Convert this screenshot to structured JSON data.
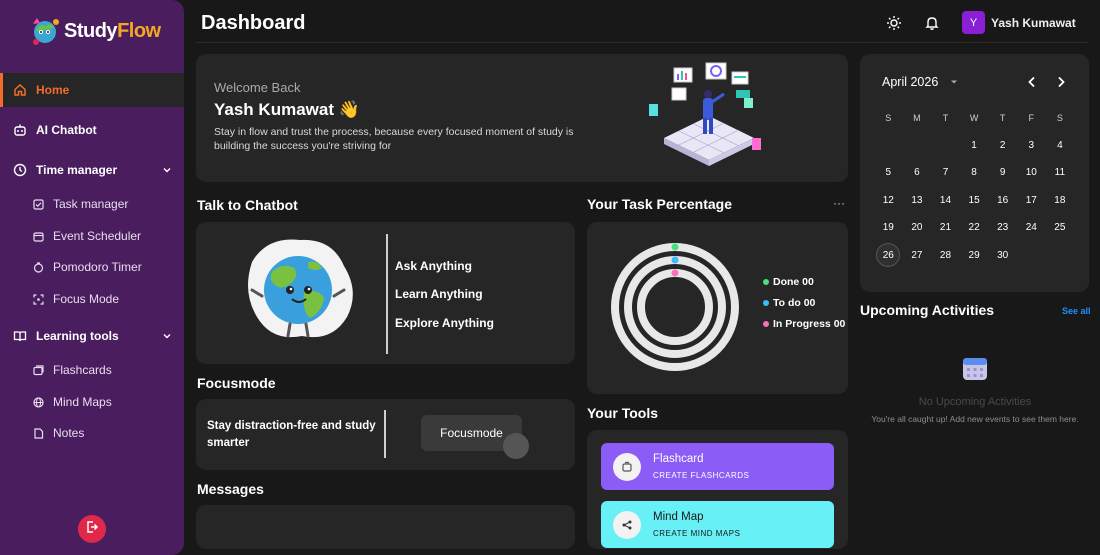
{
  "brand": {
    "name_a": "Study",
    "name_b": "Flow"
  },
  "sidebar": {
    "home": "Home",
    "chatbot": "AI Chatbot",
    "time_manager": "Time manager",
    "time_items": [
      "Task manager",
      "Event Scheduler",
      "Pomodoro Timer",
      "Focus Mode"
    ],
    "learning_tools": "Learning tools",
    "learning_items": [
      "Flashcards",
      "Mind Maps",
      "Notes"
    ]
  },
  "header": {
    "title": "Dashboard",
    "avatar_initial": "Y",
    "user_name": "Yash Kumawat"
  },
  "welcome": {
    "greeting": "Welcome Back",
    "name": "Yash Kumawat",
    "wave": "👋",
    "text": "Stay in flow and trust the process, because every focused moment of study is building the success you're striving for"
  },
  "chatbot": {
    "title": "Talk to Chatbot",
    "options": [
      "Ask Anything",
      "Learn Anything",
      "Explore Anything"
    ]
  },
  "focusmode": {
    "title": "Focusmode",
    "text": "Stay distraction-free and study smarter",
    "button": "Focusmode"
  },
  "messages": {
    "title": "Messages"
  },
  "tasks": {
    "title": "Your Task Percentage",
    "more": "···",
    "legend": [
      {
        "label": "Done 00",
        "color": "#4ade80"
      },
      {
        "label": "To do 00",
        "color": "#38bdf8"
      },
      {
        "label": "In Progress 00",
        "color": "#f472b6"
      }
    ]
  },
  "tools": {
    "title": "Your Tools",
    "items": [
      {
        "title": "Flashcard",
        "sub": "CREATE FLASHCARDS",
        "bg": "#8b5cf6",
        "fg": "#ffffff"
      },
      {
        "title": "Mind Map",
        "sub": "CREATE MIND MAPS",
        "bg": "#67f0f5",
        "fg": "#1a1a1a"
      }
    ]
  },
  "calendar": {
    "month": "April 2026",
    "weekdays": [
      "S",
      "M",
      "T",
      "W",
      "T",
      "F",
      "S"
    ],
    "weeks": [
      [
        "",
        "",
        "",
        "1",
        "2",
        "3",
        "4"
      ],
      [
        "5",
        "6",
        "7",
        "8",
        "9",
        "10",
        "11"
      ],
      [
        "12",
        "13",
        "14",
        "15",
        "16",
        "17",
        "18"
      ],
      [
        "19",
        "20",
        "21",
        "22",
        "23",
        "24",
        "25"
      ],
      [
        "26",
        "27",
        "28",
        "29",
        "30",
        "",
        ""
      ]
    ],
    "today": "26"
  },
  "upcoming": {
    "title": "Upcoming Activities",
    "see_all": "See all",
    "empty_title": "No Upcoming Activities",
    "empty_sub": "You're all caught up! Add new events to see them here."
  },
  "colors": {
    "accent": "#f26b2b",
    "sidebar": "#4a1d5e",
    "card": "#262626"
  }
}
